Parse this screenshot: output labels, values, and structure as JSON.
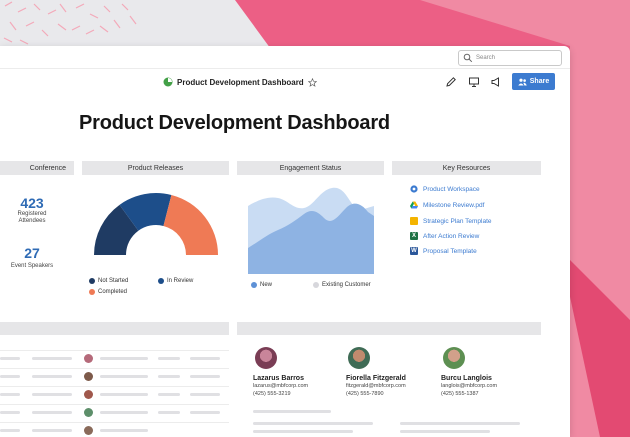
{
  "window": {
    "search_placeholder": "Search",
    "title": "Product Development Dashboard",
    "share_label": "Share"
  },
  "page": {
    "heading": "Product Development Dashboard"
  },
  "sections": {
    "conference": "Conference",
    "product_releases": "Product Releases",
    "engagement": "Engagement Status",
    "resources": "Key Resources"
  },
  "stats": [
    {
      "value": "423",
      "label_line1": "Registered",
      "label_line2": "Attendees"
    },
    {
      "value": "27",
      "label_line1": "Event Speakers",
      "label_line2": ""
    }
  ],
  "releases_legend": [
    {
      "label": "Not Started",
      "color": "#1f3b63"
    },
    {
      "label": "In Review",
      "color": "#1d4e8a"
    },
    {
      "label": "Completed",
      "color": "#ef7a55"
    }
  ],
  "releases_chart": {
    "segments": [
      {
        "label": "Not Started",
        "fraction": 0.3,
        "color": "#1f3b63"
      },
      {
        "label": "In Review",
        "fraction": 0.28,
        "color": "#1d4e8a"
      },
      {
        "label": "Completed",
        "fraction": 0.42,
        "color": "#ef7a55"
      }
    ]
  },
  "engagement_legend": [
    {
      "label": "New",
      "color": "#5e91d6"
    },
    {
      "label": "Existing Customer",
      "color": "#d7d7dc"
    }
  ],
  "resources": [
    {
      "label": "Product Workspace",
      "icon": "workspace-icon",
      "color": "#3c7bd0"
    },
    {
      "label": "Milestone Review.pdf",
      "icon": "drive-icon",
      "color": "#4ea452"
    },
    {
      "label": "Strategic Plan Template",
      "icon": "slides-icon",
      "color": "#f4b400"
    },
    {
      "label": "After Action Review",
      "icon": "excel-icon",
      "color": "#1f7244"
    },
    {
      "label": "Proposal Template",
      "icon": "word-icon",
      "color": "#2b579a"
    }
  ],
  "contacts": [
    {
      "name": "Lazarus Barros",
      "email": "lazarus@mbfcorp.com",
      "phone": "(425) 555-3219"
    },
    {
      "name": "Fiorella Fitzgerald",
      "email": "fitzgerald@mbfcorp.com",
      "phone": "(425) 555-7890"
    },
    {
      "name": "Burcu Langlois",
      "email": "langlois@mbfcorp.com",
      "phone": "(425) 555-1387"
    }
  ],
  "colors": {
    "accent": "#3c7bd0",
    "background_pink": "#ef6e8f"
  }
}
